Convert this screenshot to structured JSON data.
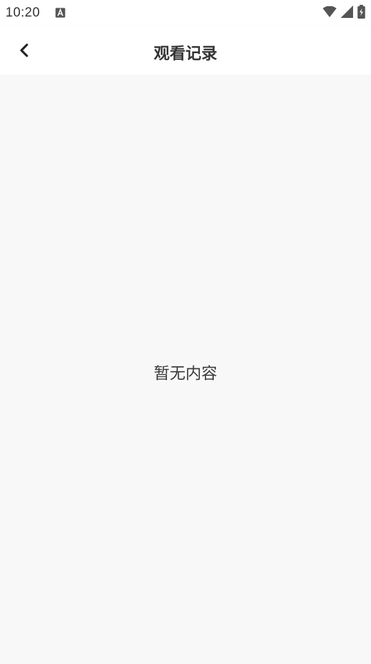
{
  "status_bar": {
    "time": "10:20",
    "icons": [
      "notification-a-icon",
      "wifi-icon",
      "cellular-signal-icon",
      "battery-charging-icon"
    ]
  },
  "header": {
    "back_icon": "chevron-left-icon",
    "title": "观看记录"
  },
  "content": {
    "empty_message": "暂无内容"
  },
  "colors": {
    "background": "#f8f8f8",
    "bar": "#ffffff",
    "text": "#333333"
  }
}
